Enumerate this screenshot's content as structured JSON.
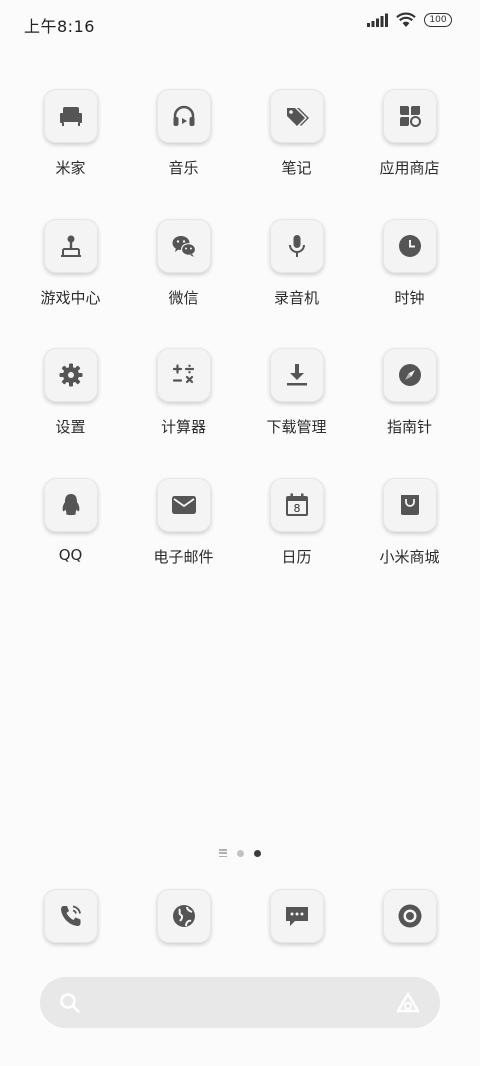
{
  "status_bar": {
    "time": "上午8:16",
    "battery": "100"
  },
  "apps": [
    {
      "label": "米家",
      "icon": "sofa-icon"
    },
    {
      "label": "音乐",
      "icon": "headphones-icon"
    },
    {
      "label": "笔记",
      "icon": "tags-icon"
    },
    {
      "label": "应用商店",
      "icon": "app-grid-icon"
    },
    {
      "label": "游戏中心",
      "icon": "joystick-icon"
    },
    {
      "label": "微信",
      "icon": "wechat-icon"
    },
    {
      "label": "录音机",
      "icon": "microphone-icon"
    },
    {
      "label": "时钟",
      "icon": "clock-icon"
    },
    {
      "label": "设置",
      "icon": "gear-icon"
    },
    {
      "label": "计算器",
      "icon": "calculator-icon"
    },
    {
      "label": "下载管理",
      "icon": "download-icon"
    },
    {
      "label": "指南针",
      "icon": "compass-icon"
    },
    {
      "label": "QQ",
      "icon": "penguin-icon"
    },
    {
      "label": "电子邮件",
      "icon": "envelope-icon"
    },
    {
      "label": "日历",
      "icon": "calendar-icon"
    },
    {
      "label": "小米商城",
      "icon": "shopping-bag-icon"
    }
  ],
  "calendar_day": "8",
  "page_indicator": {
    "pages": 2,
    "active": 2
  },
  "dock": [
    {
      "icon": "phone-icon"
    },
    {
      "icon": "browser-globe-icon"
    },
    {
      "icon": "message-icon"
    },
    {
      "icon": "camera-icon"
    }
  ],
  "search": {
    "placeholder": ""
  },
  "colors": {
    "icon_glyph": "#555555",
    "tile_bg": "#f4f4f4",
    "page_bg": "#fbfbfb",
    "search_bg": "#e8e8e8"
  }
}
